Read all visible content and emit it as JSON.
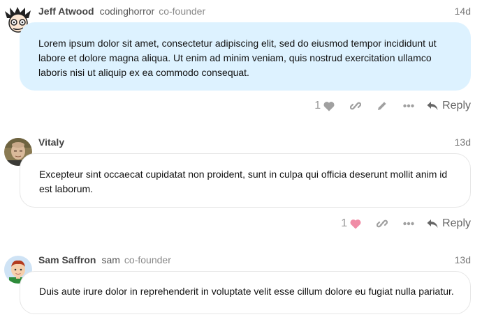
{
  "posts": [
    {
      "username": "Jeff Atwood",
      "handle": "codinghorror",
      "role": "co-founder",
      "time": "14d",
      "body": "Lorem ipsum dolor sit amet, consectetur adipiscing elit, sed do eiusmod tempor incididunt ut labore et dolore magna aliqua. Ut enim ad minim veniam, quis nostrud exercitation ullamco laboris nisi ut aliquip ex ea commodo consequat.",
      "likes": "1",
      "liked": false,
      "reply_label": "Reply",
      "highlighted": true,
      "has_badge": true
    },
    {
      "username": "Vitaly",
      "handle": "",
      "role": "",
      "time": "13d",
      "body": "Excepteur sint occaecat cupidatat non proident, sunt in culpa qui officia deserunt mollit anim id est laborum.",
      "likes": "1",
      "liked": true,
      "reply_label": "Reply",
      "highlighted": false,
      "has_badge": false
    },
    {
      "username": "Sam Saffron",
      "handle": "sam",
      "role": "co-founder",
      "time": "13d",
      "body": "Duis aute irure dolor in reprehenderit in voluptate velit esse cillum dolore eu fugiat nulla pariatur.",
      "highlighted": false,
      "has_badge": true
    }
  ],
  "colors": {
    "highlight_bg": "#ddf2ff",
    "liked_heart": "#f08ca6",
    "muted_icon": "#a0a0a0"
  }
}
